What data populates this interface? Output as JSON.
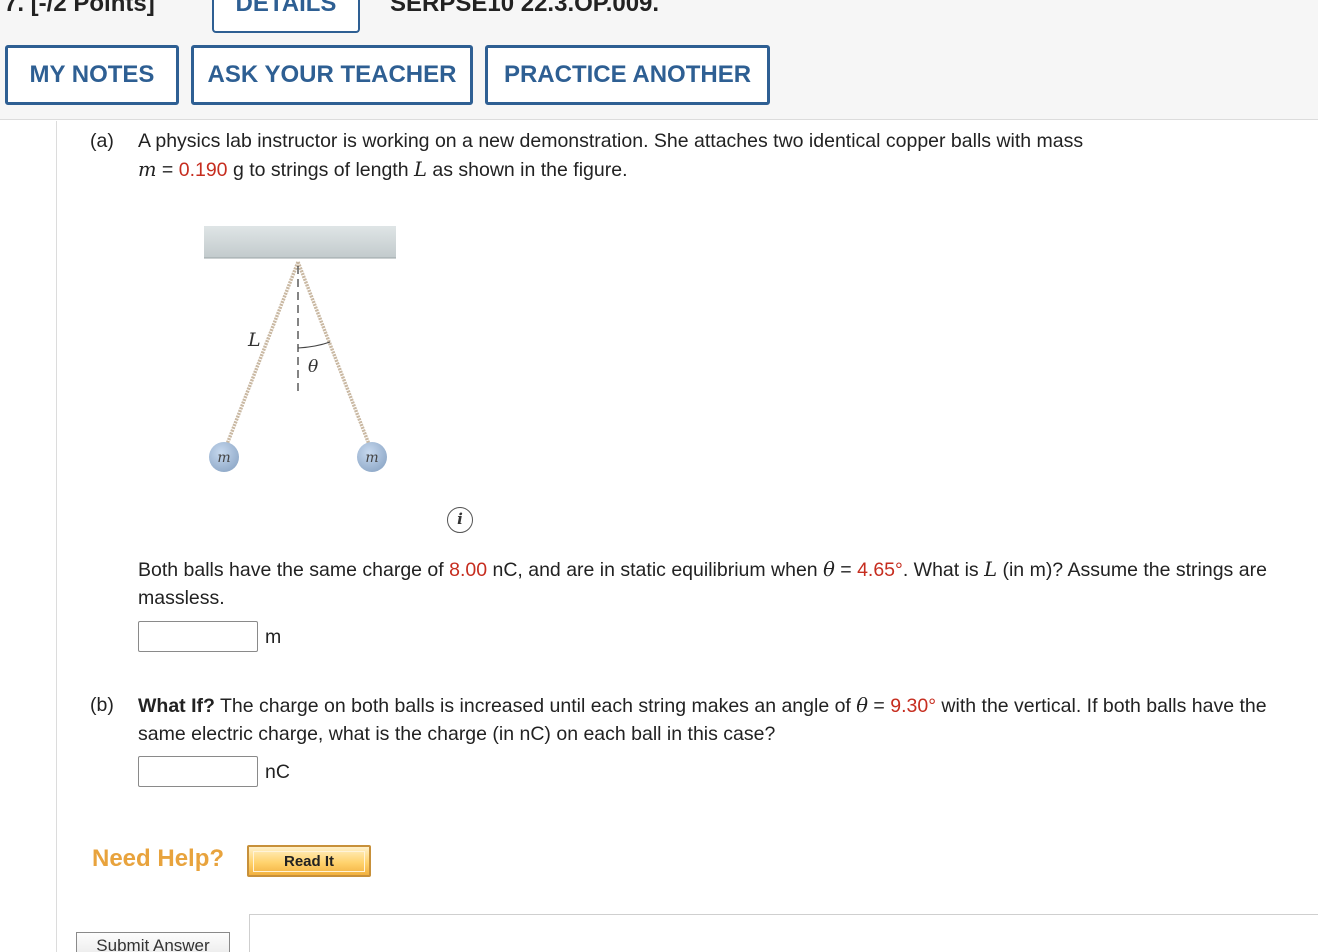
{
  "header": {
    "question_number": "7. [-/2 Points]",
    "details_tab": "DETAILS",
    "problem_code": "SERPSE10 22.3.OP.009."
  },
  "toolbar": {
    "my_notes": "MY NOTES",
    "ask_teacher": "ASK YOUR TEACHER",
    "practice_another": "PRACTICE ANOTHER"
  },
  "part_a": {
    "label": "(a)",
    "intro_1": "A physics lab instructor is working on a new demonstration. She attaches two identical copper balls with mass",
    "m_symbol": "m",
    "equals": " = ",
    "mass_value": "0.190",
    "intro_2": " g to strings of length ",
    "L_symbol": "L",
    "intro_3": " as shown in the figure.",
    "q_1": "Both balls have the same charge of ",
    "charge_value": "8.00",
    "q_2": " nC, and are in static equilibrium when ",
    "theta_symbol": "θ",
    "q_3": " = ",
    "angle_value": "4.65°",
    "q_4": ". What is ",
    "L_symbol_2": "L",
    "q_5": " (in m)? Assume the strings are massless.",
    "answer_value": "",
    "unit": "m"
  },
  "figure": {
    "length_label": "L",
    "angle_label": "θ",
    "left_ball_label": "m",
    "right_ball_label": "m",
    "info_icon_label": "i"
  },
  "part_b": {
    "label": "(b)",
    "bold_lead": "What If?",
    "q_1": " The charge on both balls is increased until each string makes an angle of ",
    "theta_symbol": "θ",
    "q_2": " = ",
    "angle_value": "9.30°",
    "q_3": " with the vertical. If both balls have the same electric charge, what is the charge (in nC) on each ball in this case?",
    "answer_value": "",
    "unit": "nC"
  },
  "help": {
    "need_help": "Need Help?",
    "read_it": "Read It"
  },
  "submit": {
    "label": "Submit Answer"
  }
}
